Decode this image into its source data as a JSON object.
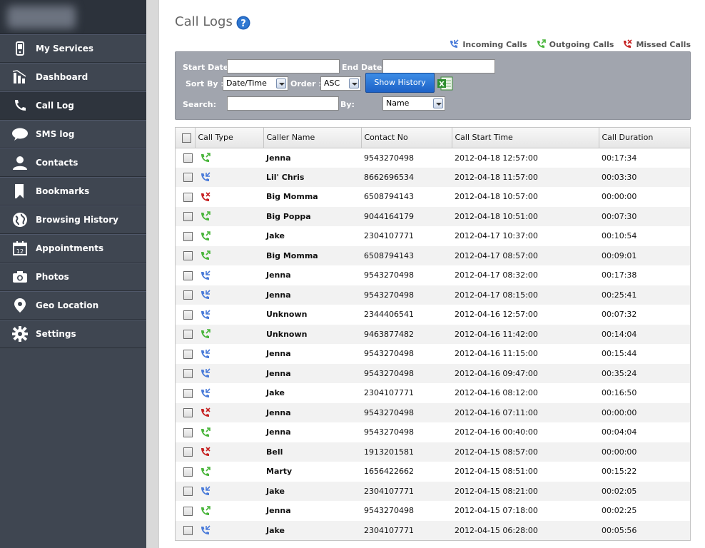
{
  "sidebar": {
    "items": [
      {
        "label": "My Services",
        "icon": "phone-icon"
      },
      {
        "label": "Dashboard",
        "icon": "dashboard-icon"
      },
      {
        "label": "Call Log",
        "icon": "call-icon"
      },
      {
        "label": "SMS log",
        "icon": "chat-bubble-icon"
      },
      {
        "label": "Contacts",
        "icon": "person-icon"
      },
      {
        "label": "Bookmarks",
        "icon": "bookmark-icon"
      },
      {
        "label": "Browsing History",
        "icon": "globe-icon"
      },
      {
        "label": "Appointments",
        "icon": "calendar-icon"
      },
      {
        "label": "Photos",
        "icon": "camera-icon"
      },
      {
        "label": "Geo Location",
        "icon": "map-pin-icon"
      },
      {
        "label": "Settings",
        "icon": "gear-icon"
      }
    ],
    "active_index": 2
  },
  "header": {
    "title": "Call Logs"
  },
  "legend": {
    "incoming": "Incoming Calls",
    "outgoing": "Outgoing Calls",
    "missed": "Missed Calls"
  },
  "filter": {
    "start_date_label": "Start Date :",
    "end_date_label": "End Date :",
    "sort_by_label": "Sort By :",
    "sort_by_value": "Date/Time",
    "order_label": "Order :",
    "order_value": "ASC",
    "show_history_label": "Show History",
    "search_label": "Search:",
    "by_label": "By:",
    "by_value": "Name"
  },
  "colors": {
    "incoming": "#4a7bd9",
    "outgoing": "#49b53b",
    "missed": "#c62222"
  },
  "table": {
    "columns": [
      "Call Type",
      "Caller Name",
      "Contact No",
      "Call Start Time",
      "Call Duration"
    ],
    "rows": [
      {
        "type": "outgoing",
        "name": "Jenna",
        "number": "9543270498",
        "start": "2012-04-18 12:57:00",
        "duration": "00:17:34"
      },
      {
        "type": "incoming",
        "name": "Lil' Chris",
        "number": "8662696534",
        "start": "2012-04-18 11:57:00",
        "duration": "00:03:30"
      },
      {
        "type": "missed",
        "name": "Big Momma",
        "number": "6508794143",
        "start": "2012-04-18 10:57:00",
        "duration": "00:00:00"
      },
      {
        "type": "outgoing",
        "name": "Big Poppa",
        "number": "9044164179",
        "start": "2012-04-18 10:51:00",
        "duration": "00:07:30"
      },
      {
        "type": "outgoing",
        "name": "Jake",
        "number": "2304107771",
        "start": "2012-04-17 10:37:00",
        "duration": "00:10:54"
      },
      {
        "type": "outgoing",
        "name": "Big Momma",
        "number": "6508794143",
        "start": "2012-04-17 08:57:00",
        "duration": "00:09:01"
      },
      {
        "type": "incoming",
        "name": "Jenna",
        "number": "9543270498",
        "start": "2012-04-17 08:32:00",
        "duration": "00:17:38"
      },
      {
        "type": "incoming",
        "name": "Jenna",
        "number": "9543270498",
        "start": "2012-04-17 08:15:00",
        "duration": "00:25:41"
      },
      {
        "type": "incoming",
        "name": "Unknown",
        "number": "2344406541",
        "start": "2012-04-16 12:57:00",
        "duration": "00:07:32"
      },
      {
        "type": "outgoing",
        "name": "Unknown",
        "number": "9463877482",
        "start": "2012-04-16 11:42:00",
        "duration": "00:14:04"
      },
      {
        "type": "incoming",
        "name": "Jenna",
        "number": "9543270498",
        "start": "2012-04-16 11:15:00",
        "duration": "00:15:44"
      },
      {
        "type": "incoming",
        "name": "Jenna",
        "number": "9543270498",
        "start": "2012-04-16 09:47:00",
        "duration": "00:35:24"
      },
      {
        "type": "incoming",
        "name": "Jake",
        "number": "2304107771",
        "start": "2012-04-16 08:12:00",
        "duration": "00:16:50"
      },
      {
        "type": "missed",
        "name": "Jenna",
        "number": "9543270498",
        "start": "2012-04-16 07:11:00",
        "duration": "00:00:00"
      },
      {
        "type": "outgoing",
        "name": "Jenna",
        "number": "9543270498",
        "start": "2012-04-16 00:40:00",
        "duration": "00:04:04"
      },
      {
        "type": "missed",
        "name": "Bell",
        "number": "1913201581",
        "start": "2012-04-15 08:57:00",
        "duration": "00:00:00"
      },
      {
        "type": "outgoing",
        "name": "Marty",
        "number": "1656422662",
        "start": "2012-04-15 08:51:00",
        "duration": "00:15:22"
      },
      {
        "type": "incoming",
        "name": "Jake",
        "number": "2304107771",
        "start": "2012-04-15 08:21:00",
        "duration": "00:02:05"
      },
      {
        "type": "outgoing",
        "name": "Jenna",
        "number": "9543270498",
        "start": "2012-04-15 07:18:00",
        "duration": "00:02:25"
      },
      {
        "type": "incoming",
        "name": "Jake",
        "number": "2304107771",
        "start": "2012-04-15 06:28:00",
        "duration": "00:05:56"
      }
    ]
  }
}
